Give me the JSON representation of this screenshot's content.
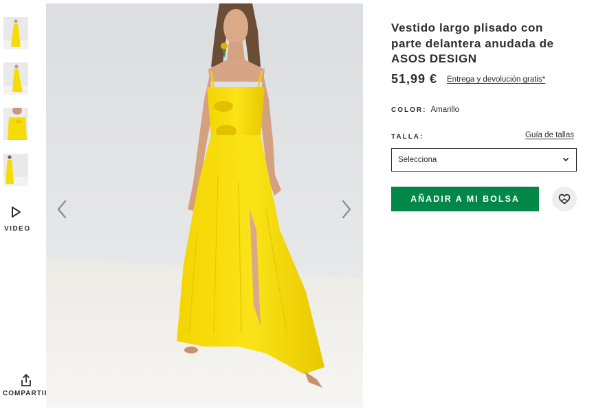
{
  "gallery": {
    "thumbnails": [
      {
        "icon": "dress-front-thumbnail"
      },
      {
        "icon": "dress-side-thumbnail"
      },
      {
        "icon": "dress-detail-thumbnail"
      },
      {
        "icon": "dress-back-thumbnail"
      }
    ],
    "video_label": "VIDEO",
    "share_label": "COMPARTIR",
    "prev_icon": "chevron-left-icon",
    "next_icon": "chevron-right-icon"
  },
  "product": {
    "title": "Vestido largo plisado con parte delantera anudada de ASOS DESIGN",
    "price": "51,99 €",
    "delivery_link": "Entrega y devolución gratis*",
    "color_label": "COLOR:",
    "color_value": "Amarillo",
    "size_label": "TALLA:",
    "size_guide_link": "Guía de tallas",
    "size_select_value": "Selecciona",
    "add_to_bag_label": "AÑADIR A MI BOLSA",
    "wishlist_icon": "heart-icon"
  },
  "colors": {
    "accent_green": "#018849",
    "dress_yellow": "#f6dc06",
    "text": "#2d2d2d",
    "wishlist_bg": "#eeeeee"
  }
}
